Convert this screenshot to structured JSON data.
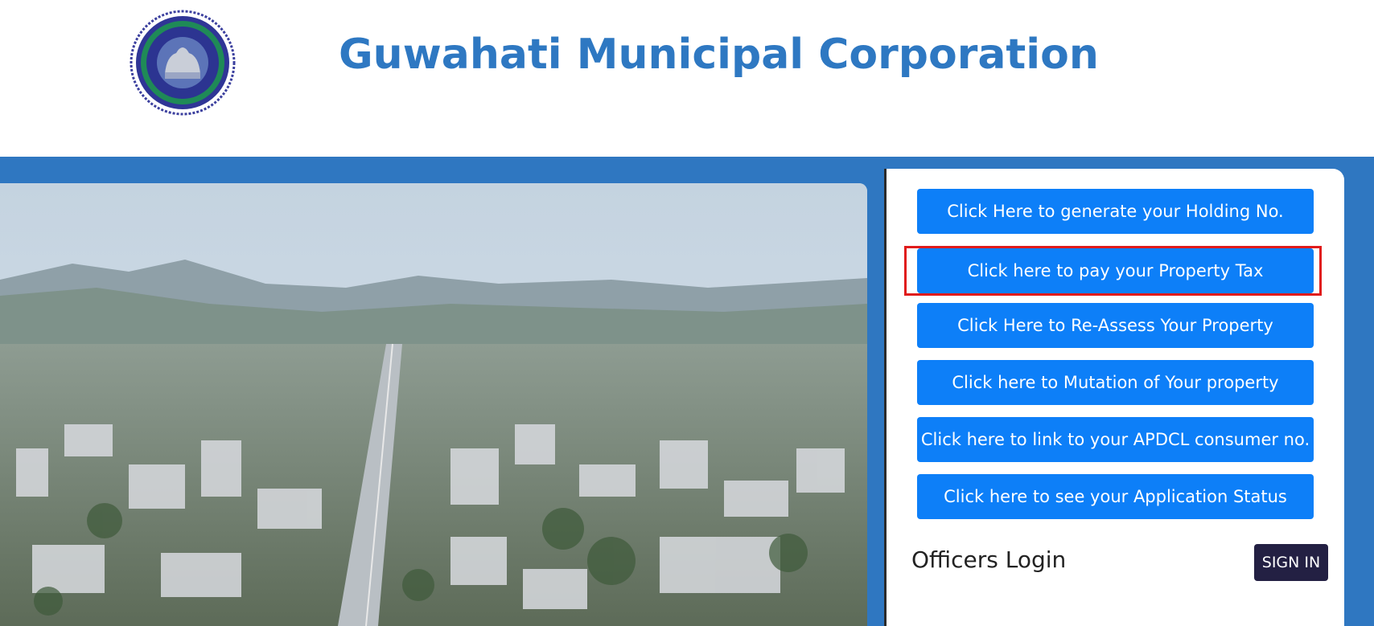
{
  "header": {
    "title": "Guwahati Municipal Corporation",
    "logo_icon": "gmc-seal-logo"
  },
  "hero": {
    "image_icon": "aerial-city-photo"
  },
  "panel": {
    "buttons": [
      {
        "label": "Click Here to generate your Holding No."
      },
      {
        "label": "Click here to pay your Property Tax",
        "highlighted": true
      },
      {
        "label": "Click Here to Re-Assess Your Property"
      },
      {
        "label": "Click here to Mutation of Your property"
      },
      {
        "label": "Click here to link to your APDCL consumer no."
      },
      {
        "label": "Click here to see your Application Status"
      }
    ],
    "officers_label": "Officers Login",
    "signin_label": "SIGN IN"
  },
  "colors": {
    "brand_blue": "#2e78c2",
    "band_blue": "#2f77c1",
    "button_blue": "#0d7ff8",
    "highlight_red": "#e01b1b",
    "signin_bg": "#232043"
  }
}
